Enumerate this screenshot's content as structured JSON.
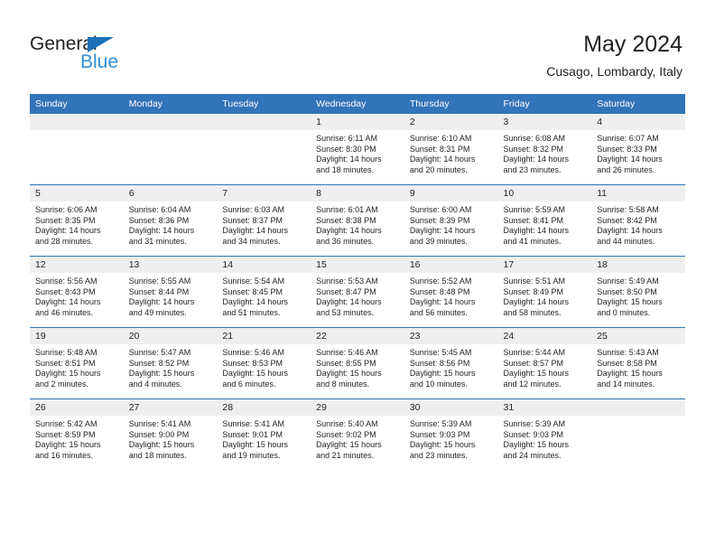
{
  "brand": {
    "name_top": "General",
    "name_bottom": "Blue",
    "triangle_color": "#1d71b8",
    "blue_text_color": "#2e8fd6"
  },
  "header": {
    "title": "May 2024",
    "subtitle": "Cusago, Lombardy, Italy",
    "header_bg_color": "#3174b8",
    "daynum_bg_color": "#efefef"
  },
  "weekday_headers": [
    "Sunday",
    "Monday",
    "Tuesday",
    "Wednesday",
    "Thursday",
    "Friday",
    "Saturday"
  ],
  "labels": {
    "sunrise_prefix": "Sunrise:",
    "sunset_prefix": "Sunset:",
    "daylight_prefix": "Daylight:"
  },
  "weeks": [
    [
      {
        "empty": true,
        "day": ""
      },
      {
        "empty": true,
        "day": ""
      },
      {
        "empty": true,
        "day": ""
      },
      {
        "empty": false,
        "day": "1",
        "sunrise": "Sunrise: 6:11 AM",
        "sunset": "Sunset: 8:30 PM",
        "daylight_line1": "Daylight: 14 hours",
        "daylight_line2": "and 18 minutes."
      },
      {
        "empty": false,
        "day": "2",
        "sunrise": "Sunrise: 6:10 AM",
        "sunset": "Sunset: 8:31 PM",
        "daylight_line1": "Daylight: 14 hours",
        "daylight_line2": "and 20 minutes."
      },
      {
        "empty": false,
        "day": "3",
        "sunrise": "Sunrise: 6:08 AM",
        "sunset": "Sunset: 8:32 PM",
        "daylight_line1": "Daylight: 14 hours",
        "daylight_line2": "and 23 minutes."
      },
      {
        "empty": false,
        "day": "4",
        "sunrise": "Sunrise: 6:07 AM",
        "sunset": "Sunset: 8:33 PM",
        "daylight_line1": "Daylight: 14 hours",
        "daylight_line2": "and 26 minutes."
      }
    ],
    [
      {
        "empty": false,
        "day": "5",
        "sunrise": "Sunrise: 6:06 AM",
        "sunset": "Sunset: 8:35 PM",
        "daylight_line1": "Daylight: 14 hours",
        "daylight_line2": "and 28 minutes."
      },
      {
        "empty": false,
        "day": "6",
        "sunrise": "Sunrise: 6:04 AM",
        "sunset": "Sunset: 8:36 PM",
        "daylight_line1": "Daylight: 14 hours",
        "daylight_line2": "and 31 minutes."
      },
      {
        "empty": false,
        "day": "7",
        "sunrise": "Sunrise: 6:03 AM",
        "sunset": "Sunset: 8:37 PM",
        "daylight_line1": "Daylight: 14 hours",
        "daylight_line2": "and 34 minutes."
      },
      {
        "empty": false,
        "day": "8",
        "sunrise": "Sunrise: 6:01 AM",
        "sunset": "Sunset: 8:38 PM",
        "daylight_line1": "Daylight: 14 hours",
        "daylight_line2": "and 36 minutes."
      },
      {
        "empty": false,
        "day": "9",
        "sunrise": "Sunrise: 6:00 AM",
        "sunset": "Sunset: 8:39 PM",
        "daylight_line1": "Daylight: 14 hours",
        "daylight_line2": "and 39 minutes."
      },
      {
        "empty": false,
        "day": "10",
        "sunrise": "Sunrise: 5:59 AM",
        "sunset": "Sunset: 8:41 PM",
        "daylight_line1": "Daylight: 14 hours",
        "daylight_line2": "and 41 minutes."
      },
      {
        "empty": false,
        "day": "11",
        "sunrise": "Sunrise: 5:58 AM",
        "sunset": "Sunset: 8:42 PM",
        "daylight_line1": "Daylight: 14 hours",
        "daylight_line2": "and 44 minutes."
      }
    ],
    [
      {
        "empty": false,
        "day": "12",
        "sunrise": "Sunrise: 5:56 AM",
        "sunset": "Sunset: 8:43 PM",
        "daylight_line1": "Daylight: 14 hours",
        "daylight_line2": "and 46 minutes."
      },
      {
        "empty": false,
        "day": "13",
        "sunrise": "Sunrise: 5:55 AM",
        "sunset": "Sunset: 8:44 PM",
        "daylight_line1": "Daylight: 14 hours",
        "daylight_line2": "and 49 minutes."
      },
      {
        "empty": false,
        "day": "14",
        "sunrise": "Sunrise: 5:54 AM",
        "sunset": "Sunset: 8:45 PM",
        "daylight_line1": "Daylight: 14 hours",
        "daylight_line2": "and 51 minutes."
      },
      {
        "empty": false,
        "day": "15",
        "sunrise": "Sunrise: 5:53 AM",
        "sunset": "Sunset: 8:47 PM",
        "daylight_line1": "Daylight: 14 hours",
        "daylight_line2": "and 53 minutes."
      },
      {
        "empty": false,
        "day": "16",
        "sunrise": "Sunrise: 5:52 AM",
        "sunset": "Sunset: 8:48 PM",
        "daylight_line1": "Daylight: 14 hours",
        "daylight_line2": "and 56 minutes."
      },
      {
        "empty": false,
        "day": "17",
        "sunrise": "Sunrise: 5:51 AM",
        "sunset": "Sunset: 8:49 PM",
        "daylight_line1": "Daylight: 14 hours",
        "daylight_line2": "and 58 minutes."
      },
      {
        "empty": false,
        "day": "18",
        "sunrise": "Sunrise: 5:49 AM",
        "sunset": "Sunset: 8:50 PM",
        "daylight_line1": "Daylight: 15 hours",
        "daylight_line2": "and 0 minutes."
      }
    ],
    [
      {
        "empty": false,
        "day": "19",
        "sunrise": "Sunrise: 5:48 AM",
        "sunset": "Sunset: 8:51 PM",
        "daylight_line1": "Daylight: 15 hours",
        "daylight_line2": "and 2 minutes."
      },
      {
        "empty": false,
        "day": "20",
        "sunrise": "Sunrise: 5:47 AM",
        "sunset": "Sunset: 8:52 PM",
        "daylight_line1": "Daylight: 15 hours",
        "daylight_line2": "and 4 minutes."
      },
      {
        "empty": false,
        "day": "21",
        "sunrise": "Sunrise: 5:46 AM",
        "sunset": "Sunset: 8:53 PM",
        "daylight_line1": "Daylight: 15 hours",
        "daylight_line2": "and 6 minutes."
      },
      {
        "empty": false,
        "day": "22",
        "sunrise": "Sunrise: 5:46 AM",
        "sunset": "Sunset: 8:55 PM",
        "daylight_line1": "Daylight: 15 hours",
        "daylight_line2": "and 8 minutes."
      },
      {
        "empty": false,
        "day": "23",
        "sunrise": "Sunrise: 5:45 AM",
        "sunset": "Sunset: 8:56 PM",
        "daylight_line1": "Daylight: 15 hours",
        "daylight_line2": "and 10 minutes."
      },
      {
        "empty": false,
        "day": "24",
        "sunrise": "Sunrise: 5:44 AM",
        "sunset": "Sunset: 8:57 PM",
        "daylight_line1": "Daylight: 15 hours",
        "daylight_line2": "and 12 minutes."
      },
      {
        "empty": false,
        "day": "25",
        "sunrise": "Sunrise: 5:43 AM",
        "sunset": "Sunset: 8:58 PM",
        "daylight_line1": "Daylight: 15 hours",
        "daylight_line2": "and 14 minutes."
      }
    ],
    [
      {
        "empty": false,
        "day": "26",
        "sunrise": "Sunrise: 5:42 AM",
        "sunset": "Sunset: 8:59 PM",
        "daylight_line1": "Daylight: 15 hours",
        "daylight_line2": "and 16 minutes."
      },
      {
        "empty": false,
        "day": "27",
        "sunrise": "Sunrise: 5:41 AM",
        "sunset": "Sunset: 9:00 PM",
        "daylight_line1": "Daylight: 15 hours",
        "daylight_line2": "and 18 minutes."
      },
      {
        "empty": false,
        "day": "28",
        "sunrise": "Sunrise: 5:41 AM",
        "sunset": "Sunset: 9:01 PM",
        "daylight_line1": "Daylight: 15 hours",
        "daylight_line2": "and 19 minutes."
      },
      {
        "empty": false,
        "day": "29",
        "sunrise": "Sunrise: 5:40 AM",
        "sunset": "Sunset: 9:02 PM",
        "daylight_line1": "Daylight: 15 hours",
        "daylight_line2": "and 21 minutes."
      },
      {
        "empty": false,
        "day": "30",
        "sunrise": "Sunrise: 5:39 AM",
        "sunset": "Sunset: 9:03 PM",
        "daylight_line1": "Daylight: 15 hours",
        "daylight_line2": "and 23 minutes."
      },
      {
        "empty": false,
        "day": "31",
        "sunrise": "Sunrise: 5:39 AM",
        "sunset": "Sunset: 9:03 PM",
        "daylight_line1": "Daylight: 15 hours",
        "daylight_line2": "and 24 minutes."
      },
      {
        "empty": true,
        "day": ""
      }
    ]
  ]
}
